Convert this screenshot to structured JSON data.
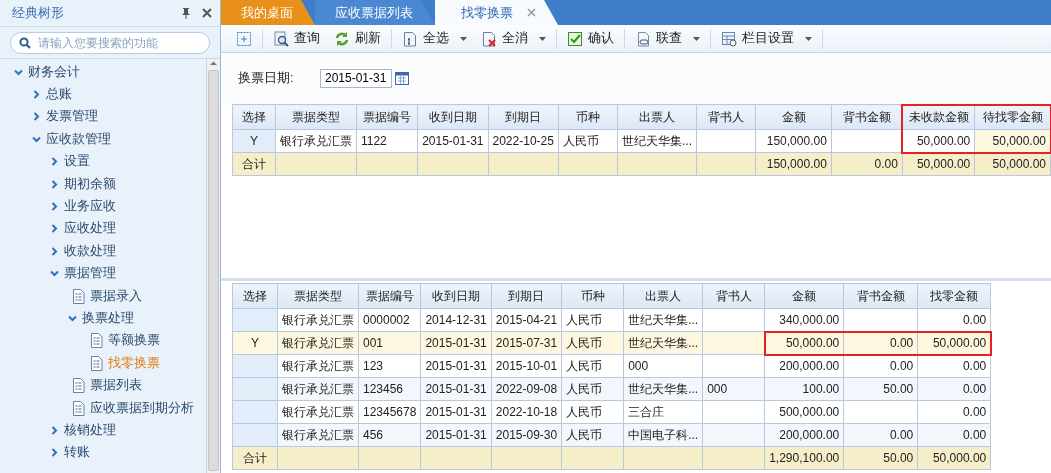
{
  "sidebar": {
    "title": "经典树形",
    "search": {
      "placeholder": "请输入您要搜索的功能"
    },
    "items": [
      {
        "label": "财务会计",
        "kind": "folder",
        "expanded": true,
        "selected": false,
        "children": [
          {
            "label": "总账",
            "kind": "folder",
            "expanded": false,
            "selected": false
          },
          {
            "label": "发票管理",
            "kind": "folder",
            "expanded": false,
            "selected": false
          },
          {
            "label": "应收款管理",
            "kind": "folder",
            "expanded": true,
            "selected": false,
            "children": [
              {
                "label": "设置",
                "kind": "folder",
                "expanded": false,
                "selected": false
              },
              {
                "label": "期初余额",
                "kind": "folder",
                "expanded": false,
                "selected": false
              },
              {
                "label": "业务应收",
                "kind": "folder",
                "expanded": false,
                "selected": false
              },
              {
                "label": "应收处理",
                "kind": "folder",
                "expanded": false,
                "selected": false
              },
              {
                "label": "收款处理",
                "kind": "folder",
                "expanded": false,
                "selected": false
              },
              {
                "label": "票据管理",
                "kind": "folder",
                "expanded": true,
                "selected": false,
                "children": [
                  {
                    "label": "票据录入",
                    "kind": "page",
                    "selected": false
                  },
                  {
                    "label": "换票处理",
                    "kind": "folder",
                    "expanded": true,
                    "selected": false,
                    "children": [
                      {
                        "label": "等额换票",
                        "kind": "page",
                        "selected": false
                      },
                      {
                        "label": "找零换票",
                        "kind": "page",
                        "selected": true
                      }
                    ]
                  },
                  {
                    "label": "票据列表",
                    "kind": "page",
                    "selected": false
                  },
                  {
                    "label": "应收票据到期分析",
                    "kind": "page",
                    "selected": false
                  }
                ]
              },
              {
                "label": "核销处理",
                "kind": "folder",
                "expanded": false,
                "selected": false
              },
              {
                "label": "转账",
                "kind": "folder",
                "expanded": false,
                "selected": false
              }
            ]
          }
        ]
      }
    ]
  },
  "tabs": [
    {
      "label": "我的桌面",
      "kind": "home",
      "selected": false,
      "closable": false
    },
    {
      "label": "应收票据列表",
      "kind": "page",
      "selected": false,
      "closable": false
    },
    {
      "label": "找零换票",
      "kind": "page",
      "selected": true,
      "closable": true
    }
  ],
  "toolbar": [
    {
      "kind": "add",
      "has_menu": false
    },
    {
      "kind": "query",
      "label": "查询",
      "has_menu": false
    },
    {
      "kind": "refresh",
      "label": "刷新",
      "has_menu": false
    },
    {
      "kind": "selectall",
      "label": "全选",
      "has_menu": true
    },
    {
      "kind": "deselect",
      "label": "全消",
      "has_menu": true
    },
    {
      "kind": "confirm",
      "label": "确认",
      "has_menu": false
    },
    {
      "kind": "link",
      "label": "联查",
      "has_menu": true
    },
    {
      "kind": "columns",
      "label": "栏目设置",
      "has_menu": true
    }
  ],
  "filter": {
    "label": "换票日期:",
    "value": "2015-01-31"
  },
  "grids": [
    {
      "highlight_header": true,
      "columns": [
        {
          "label": "选择",
          "kind": "mark"
        },
        {
          "label": "票据类型",
          "kind": "text"
        },
        {
          "label": "票据编号",
          "kind": "text"
        },
        {
          "label": "收到日期",
          "kind": "text"
        },
        {
          "label": "到期日",
          "kind": "text"
        },
        {
          "label": "币种",
          "kind": "text"
        },
        {
          "label": "出票人",
          "kind": "text"
        },
        {
          "label": "背书人",
          "kind": "text"
        },
        {
          "label": "金额",
          "kind": "amount"
        },
        {
          "label": "背书金额",
          "kind": "amount"
        },
        {
          "label": "未收款金额",
          "kind": "amount",
          "highlighted": true
        },
        {
          "label": "待找零金额",
          "kind": "amount",
          "highlighted": true,
          "editable": true
        }
      ],
      "rows": [
        {
          "current": false,
          "highlighted": true,
          "select": "Y",
          "bill_type": "银行承兑汇票",
          "bill_no": "1122",
          "received": "2015-01-31",
          "due": "2022-10-25",
          "currency": "人民币",
          "drawer": "世纪天华集...",
          "amount": "150,000.00",
          "unpaid_amount": "50,000.00",
          "change_due": "50,000.00"
        }
      ],
      "total": {
        "label": "合计",
        "amount": "150,000.00",
        "endorsed_amount": "0.00",
        "unpaid_amount": "50,000.00",
        "change_due": "50,000.00"
      }
    },
    {
      "highlight_header": false,
      "columns": [
        {
          "label": "选择",
          "kind": "mark"
        },
        {
          "label": "票据类型",
          "kind": "text"
        },
        {
          "label": "票据编号",
          "kind": "text"
        },
        {
          "label": "收到日期",
          "kind": "text"
        },
        {
          "label": "到期日",
          "kind": "text"
        },
        {
          "label": "币种",
          "kind": "text"
        },
        {
          "label": "出票人",
          "kind": "text"
        },
        {
          "label": "背书人",
          "kind": "text"
        },
        {
          "label": "金额",
          "kind": "amount",
          "highlighted": true
        },
        {
          "label": "背书金额",
          "kind": "amount",
          "highlighted": true
        },
        {
          "label": "找零金额",
          "kind": "amount",
          "highlighted": true
        }
      ],
      "rows": [
        {
          "current": false,
          "bill_type": "银行承兑汇票",
          "bill_no": "0000002",
          "received": "2014-12-31",
          "due": "2015-04-21",
          "currency": "人民币",
          "drawer": "世纪天华集...",
          "amount": "340,000.00",
          "change_amount": "0.00"
        },
        {
          "current": true,
          "highlighted": true,
          "select": "Y",
          "bill_type": "银行承兑汇票",
          "bill_no": "001",
          "received": "2015-01-31",
          "due": "2015-07-31",
          "currency": "人民币",
          "drawer": "世纪天华集...",
          "amount": "50,000.00",
          "endorsed_amount": "0.00",
          "change_amount": "50,000.00"
        },
        {
          "current": false,
          "bill_type": "银行承兑汇票",
          "bill_no": "123",
          "received": "2015-01-31",
          "due": "2015-10-01",
          "currency": "人民币",
          "drawer": "000",
          "amount": "200,000.00",
          "endorsed_amount": "0.00",
          "change_amount": "0.00"
        },
        {
          "current": false,
          "bill_type": "银行承兑汇票",
          "bill_no": "123456",
          "received": "2015-01-31",
          "due": "2022-09-08",
          "currency": "人民币",
          "drawer": "世纪天华集...",
          "endorser": "000",
          "amount": "100.00",
          "endorsed_amount": "50.00",
          "change_amount": "0.00"
        },
        {
          "current": false,
          "bill_type": "银行承兑汇票",
          "bill_no": "12345678",
          "received": "2015-01-31",
          "due": "2022-10-18",
          "currency": "人民币",
          "drawer": "三合庄",
          "amount": "500,000.00",
          "change_amount": "0.00"
        },
        {
          "current": false,
          "bill_type": "银行承兑汇票",
          "bill_no": "456",
          "received": "2015-01-31",
          "due": "2015-09-30",
          "currency": "人民币",
          "drawer": "中国电子科...",
          "amount": "200,000.00",
          "endorsed_amount": "0.00",
          "change_amount": "0.00"
        }
      ],
      "total": {
        "label": "合计",
        "amount": "1,290,100.00",
        "endorsed_amount": "50.00",
        "change_amount": "50,000.00"
      }
    }
  ]
}
